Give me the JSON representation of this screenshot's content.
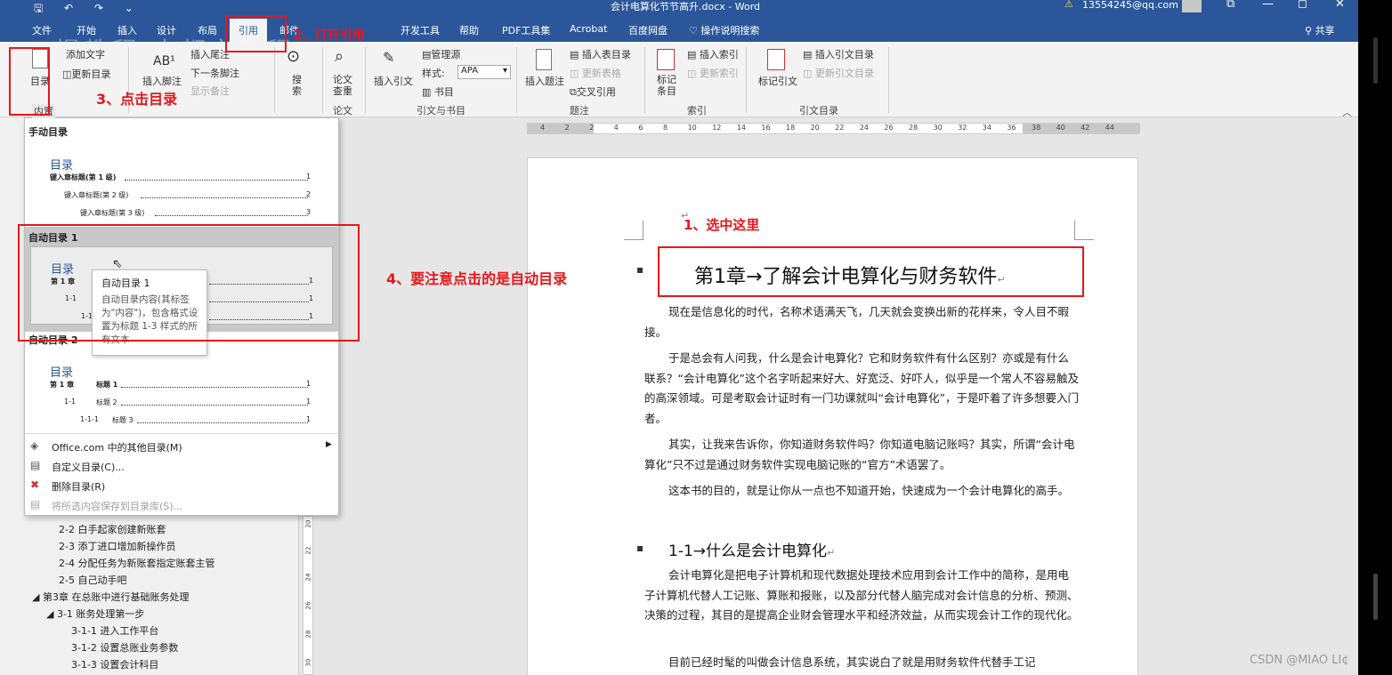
{
  "titlebar": {
    "quick_access": "🖫 ↶ ↷ ⌄",
    "doc_title": "会计电算化节节高升.docx  -  Word",
    "account": "13554245@qq.com",
    "win_restore": "⧉",
    "win_min": "—",
    "win_max": "◻",
    "win_close": "✕"
  },
  "tabs": {
    "file": "文件",
    "home": "开始",
    "insert": "插入",
    "design": "设计",
    "layout": "布局",
    "references": "引用",
    "mailings": "邮件",
    "developer": "开发工具",
    "help": "帮助",
    "pdf": "PDF工具集",
    "acrobat": "Acrobat",
    "baidu": "百度网盘",
    "tell_me": "操作说明搜索",
    "share": "共享"
  },
  "ribbon": {
    "toc_button": "目录",
    "add_text": "添加文字",
    "update_toc": "更新目录",
    "insert_footnote": "插入脚注",
    "insert_endnote": "插入尾注",
    "next_footnote": "下一条脚注",
    "show_notes": "显示备注",
    "search": "搜索",
    "research": "论文查重",
    "insert_citation": "插入引文",
    "manage_sources": "管理源",
    "style_label": "样式:",
    "style_value": "APA",
    "bibliography": "书目",
    "insert_caption": "插入题注",
    "insert_table_of_figures": "插入表目录",
    "update_table": "更新表格",
    "cross_reference": "交叉引用",
    "mark_entry": "标记条目",
    "insert_index": "插入索引",
    "update_index": "更新索引",
    "mark_citation": "标记引文",
    "insert_toa": "插入引文目录",
    "update_toa": "更新引文目录",
    "group_research": "论文",
    "group_citations": "引文与书目",
    "group_captions": "题注",
    "group_index": "索引",
    "group_toa": "引文目录"
  },
  "ruler": {
    "ticks": [
      "4",
      "2",
      "2",
      "4",
      "6",
      "8",
      "10",
      "12",
      "14",
      "16",
      "18",
      "20",
      "22",
      "24",
      "26",
      "28",
      "30",
      "32",
      "34",
      "36",
      "38",
      "40",
      "42",
      "44"
    ]
  },
  "gallery": {
    "builtin": "内置",
    "manual_title": "手动目录",
    "manual_toc_head": "目录",
    "manual_l1": "键入章标题(第 1 级)",
    "manual_l2": "键入章标题(第 2 级)",
    "manual_l3": "键入章标题(第 3 级)",
    "manual_p1": "1",
    "manual_p2": "2",
    "manual_p3": "3",
    "auto1_title": "自动目录 1",
    "auto1_toc_head": "目录",
    "auto1_l1": "第 1 章",
    "auto1_l2": "1-1",
    "auto1_l3": "1-1-1",
    "auto1_p": "1",
    "auto2_title": "自动目录 2",
    "auto2_toc_head": "目录",
    "auto2_l1a": "第 1 章",
    "auto2_l1b": "标题 1",
    "auto2_l2a": "1-1",
    "auto2_l2b": "标题 2",
    "auto2_l3a": "1-1-1",
    "auto2_l3b": "标题 3",
    "auto2_p": "1",
    "more_office": "Office.com 中的其他目录(M)",
    "custom": "自定义目录(C)...",
    "remove": "删除目录(R)",
    "save_selection": "将所选内容保存到目录库(S)..."
  },
  "tooltip": {
    "title": "自动目录 1",
    "body": "自动目录内容(其标签为\"内容\")，包含格式设置为标题 1-3 样式的所有文本"
  },
  "nav": {
    "items": [
      "2-2 白手起家创建新账套",
      "2-3 添丁进口增加新操作员",
      "2-4 分配任务为新账套指定账套主管",
      "2-5 自己动手吧",
      "第3章 在总账中进行基础账务处理",
      "3-1 账务处理第一步",
      "3-1-1 进入工作平台",
      "3-1-2 设置总账业务参数",
      "3-1-3 设置会计科目"
    ]
  },
  "vruler": {
    "ticks": [
      "20",
      "22",
      "24",
      "26",
      "28",
      "30"
    ]
  },
  "document": {
    "heading1": "第1章→了解会计电算化与财务软件",
    "p1": "现在是信息化的时代，名称术语满天飞，几天就会变换出新的花样来，令人目不暇接。",
    "p2": "于是总会有人问我，什么是会计电算化？它和财务软件有什么区别？亦或是有什么联系？“会计电算化”这个名字听起来好大、好宽泛、好吓人，似乎是一个常人不容易触及的高深领域。可是考取会计证时有一门功课就叫“会计电算化”，于是吓着了许多想要入门者。",
    "p3": "其实，让我来告诉你，你知道财务软件吗？你知道电脑记账吗？其实，所谓“会计电算化”只不过是通过财务软件实现电脑记账的“官方”术语罢了。",
    "p4": "这本书的目的，就是让你从一点也不知道开始，快速成为一个会计电算化的高手。",
    "heading2": "1-1→什么是会计电算化",
    "p5": "会计电算化是把电子计算机和现代数据处理技术应用到会计工作中的简称，是用电子计算机代替人工记账、算账和报账，以及部分代替人脑完成对会计信息的分析、预测、决策的过程，其目的是提高企业财会管理水平和经济效益，从而实现会计工作的现代化。",
    "p6": "目前已经时髦的叫做会计信息系统，其实说白了就是用财务软件代替手工记"
  },
  "annotations": {
    "step1": "1、选中这里",
    "step2": "2、打开引用",
    "step3": "3、点击目录",
    "step4": "4、要注意点击的是自动目录",
    "watermark": "慢教程·大都市教程"
  },
  "footer": {
    "csdn": "CSDN @MIAO    LI¢"
  },
  "colors": {
    "word_blue": "#2b579a",
    "annotation_red": "#e8161b"
  }
}
